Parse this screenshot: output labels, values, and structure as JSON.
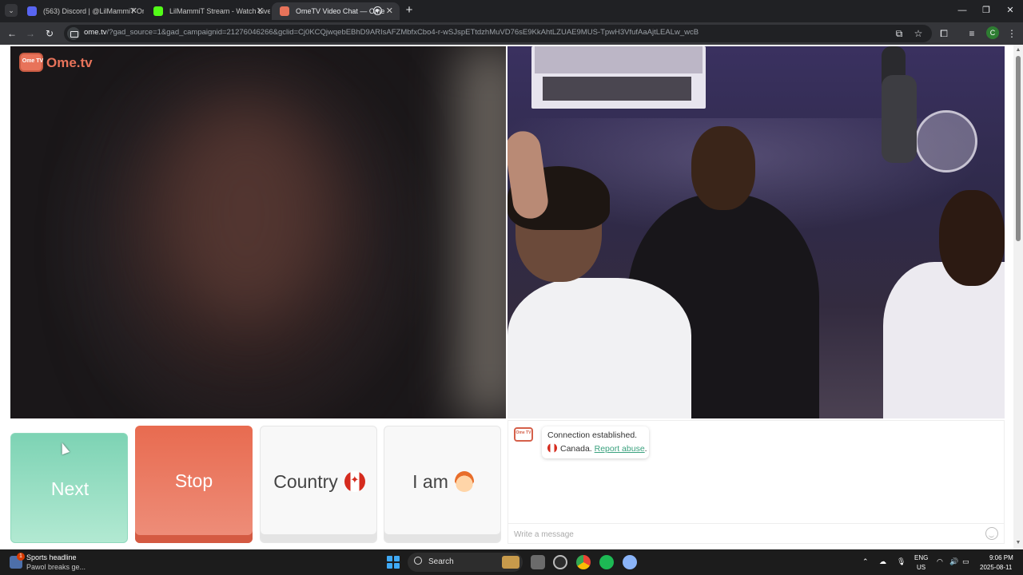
{
  "browser": {
    "tabs": [
      {
        "title": "(563) Discord | @LilMammiT Or",
        "favicon_color": "#5865f2",
        "active": false
      },
      {
        "title": "LilMammiT Stream - Watch Live",
        "favicon_color": "#53fc18",
        "active": false
      },
      {
        "title": "OmeTV Video Chat — Ome",
        "favicon_color": "#e8735a",
        "active": true
      }
    ],
    "url_host": "ome.tv",
    "url_rest": "/?gad_source=1&gad_campaignid=21276046266&gclid=Cj0KCQjwqebEBhD9ARIsAFZMbfxCbo4-r-wSJspETtdzhMuVD76sE9KkAhtLZUAE9MUS-TpwH3VfufAaAjtLEALw_wcB",
    "profile_initial": "C",
    "icons": {
      "back": "back-arrow-icon",
      "forward": "forward-arrow-icon",
      "reload": "reload-icon",
      "new_tab": "plus-icon"
    }
  },
  "site": {
    "logo_text": "Ome.tv",
    "logo_badge": "Ome TV",
    "controls": {
      "next": "Next",
      "stop": "Stop",
      "country": "Country",
      "iam": "I am"
    },
    "chat": {
      "connection_msg": "Connection established.",
      "country": "Canada.",
      "report": "Report abuse",
      "report_suffix": ".",
      "placeholder": "Write a message"
    },
    "colors": {
      "next": "#7dd3b4",
      "stop": "#e86b50",
      "accent": "#e8735a",
      "link": "#3aa17e"
    }
  },
  "taskbar": {
    "news_title": "Sports headline",
    "news_sub": "Pawol breaks ge...",
    "news_badge": "1",
    "search_label": "Search",
    "lang_top": "ENG",
    "lang_bottom": "US",
    "time": "9:06 PM",
    "date": "2025-08-11"
  }
}
